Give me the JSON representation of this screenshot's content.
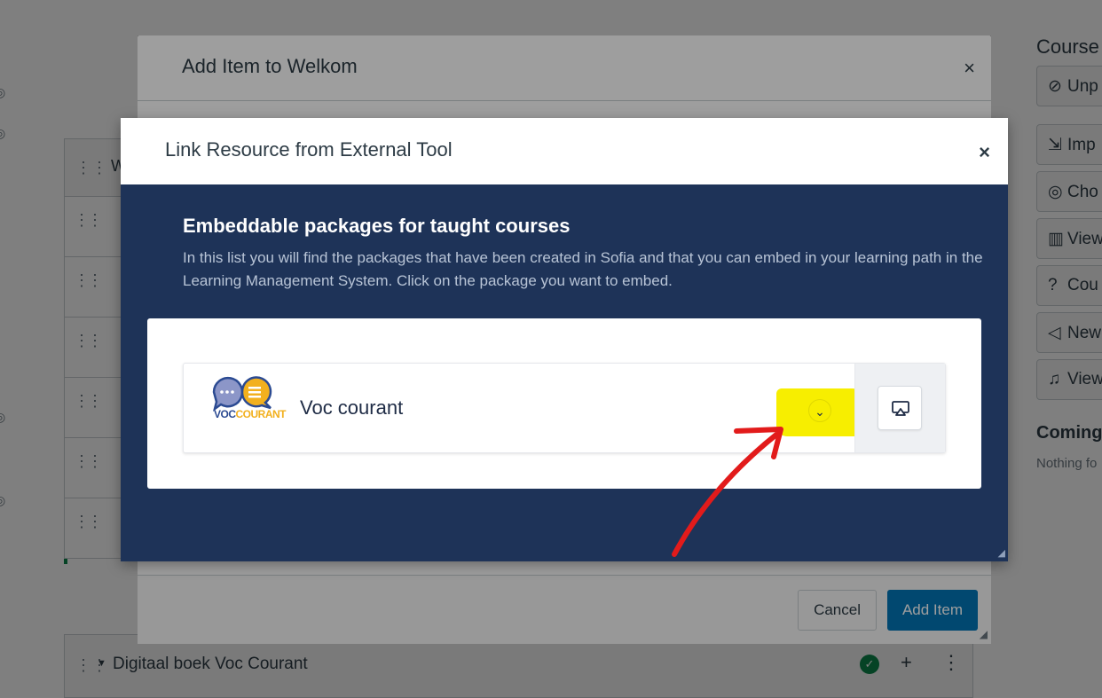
{
  "background": {
    "module_title": "Digitaal boek Voc Courant",
    "module_initial": "W",
    "sidebar": {
      "title": "Course",
      "buttons": [
        "Unp",
        "Imp",
        "Cho",
        "View",
        "Cou",
        "New",
        "View"
      ],
      "coming_up": "Coming",
      "nothing": "Nothing fo"
    }
  },
  "add_item_modal": {
    "title": "Add Item to Welkom",
    "close": "×",
    "cancel_label": "Cancel",
    "add_label": "Add Item"
  },
  "link_resource_modal": {
    "title": "Link Resource from External Tool",
    "close": "×",
    "heading": "Embeddable packages for taught courses",
    "description": "In this list you will find the packages that have been created in Sofia and that you can embed in your learning path in the Learning Management System. Click on the package you want to embed.",
    "package": {
      "name": "Voc courant",
      "logo_text_a": "VOC",
      "logo_text_b": "COURANT",
      "expand_icon": "chevron-down-icon",
      "embed_icon": "airplay-icon"
    }
  },
  "colors": {
    "modal_body": "#1e3358",
    "highlight": "#f7ee00",
    "arrow": "#e21b1b",
    "primary_button": "#0374b5"
  }
}
